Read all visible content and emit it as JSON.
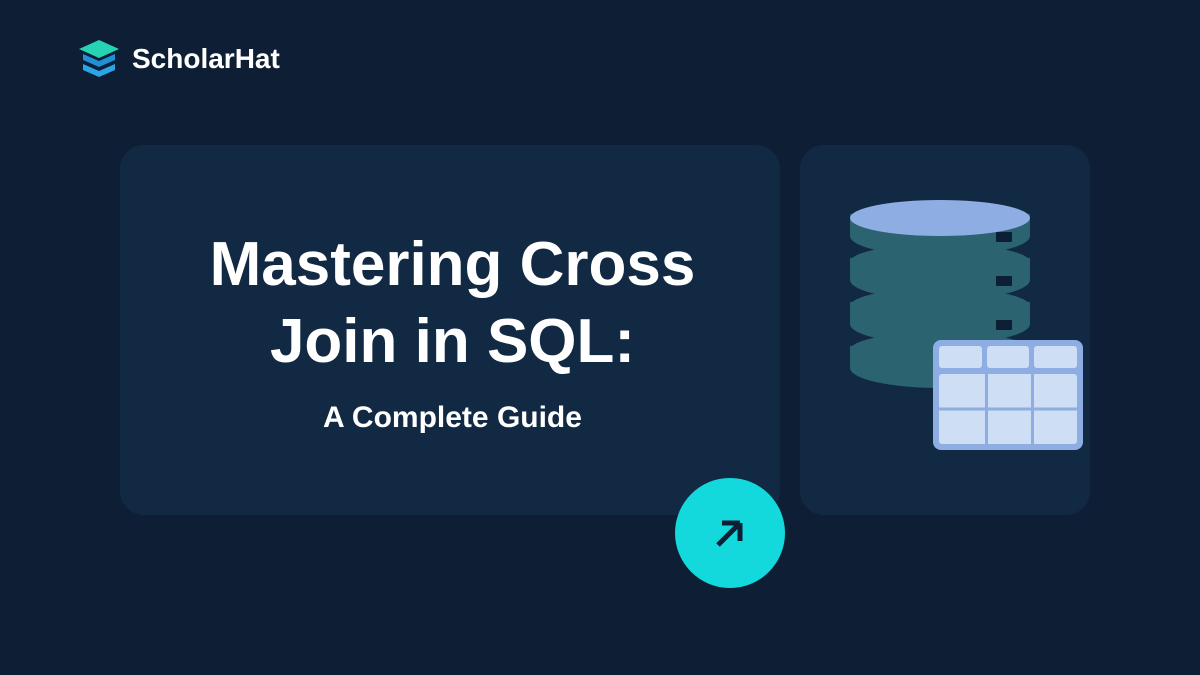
{
  "brand": {
    "name": "ScholarHat"
  },
  "content": {
    "title": "Mastering Cross Join in SQL:",
    "subtitle": "A Complete Guide"
  },
  "colors": {
    "background": "#0e1f35",
    "card_bg": "#122943",
    "accent_cyan": "#13d9dd",
    "db_light": "#8eaee3",
    "db_dark": "#2b6370",
    "table_light": "#cedff5"
  }
}
